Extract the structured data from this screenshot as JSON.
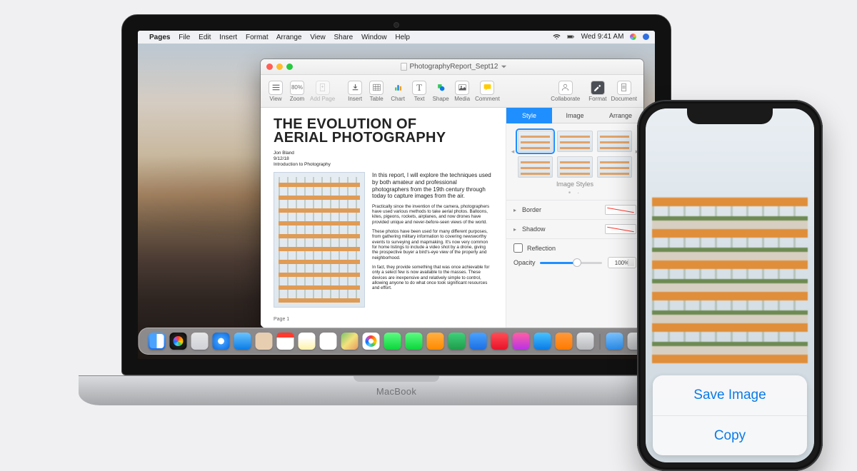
{
  "laptop_label": "MacBook",
  "menubar": {
    "app_items": [
      "Pages",
      "File",
      "Edit",
      "Insert",
      "Format",
      "Arrange",
      "View",
      "Share",
      "Window",
      "Help"
    ],
    "clock": "Wed 9:41 AM"
  },
  "pages": {
    "doc_title": "PhotographyReport_Sept12",
    "toolbar": {
      "view": "View",
      "zoom_pct": "80%",
      "zoom": "Zoom",
      "add_page": "Add Page",
      "insert": "Insert",
      "table": "Table",
      "chart": "Chart",
      "text": "Text",
      "shape": "Shape",
      "media": "Media",
      "comment": "Comment",
      "collaborate": "Collaborate",
      "format": "Format",
      "document": "Document"
    },
    "document": {
      "heading_l1": "THE EVOLUTION OF",
      "heading_l2": "AERIAL PHOTOGRAPHY",
      "author": "Jon Bland",
      "date": "9/12/18",
      "subtitle": "Introduction to Photography",
      "lead": "In this report, I will explore the techniques used by both amateur and professional photographers from the 19th century through today to capture images from the air.",
      "p1": "Practically since the invention of the camera, photographers have used various methods to take aerial photos. Balloons, kites, pigeons, rockets, airplanes, and now drones have provided unique and never-before-seen views of the world.",
      "p2": "These photos have been used for many different purposes, from gathering military information to covering newsworthy events to surveying and mapmaking. It's now very common for home listings to include a video shot by a drone, giving the prospective buyer a bird's-eye view of the property and neighborhood.",
      "p3": "In fact, they provide something that was once achievable for only a select few is now available to the masses. These devices are inexpensive and relatively simple to control, allowing anyone to do what once took significant resources and effort.",
      "page_label": "Page 1"
    },
    "inspector": {
      "tab_style": "Style",
      "tab_image": "Image",
      "tab_arrange": "Arrange",
      "image_styles": "Image Styles",
      "border": "Border",
      "shadow": "Shadow",
      "reflection": "Reflection",
      "opacity": "Opacity",
      "opacity_val": "100%"
    }
  },
  "iphone": {
    "save_image": "Save Image",
    "copy": "Copy"
  }
}
